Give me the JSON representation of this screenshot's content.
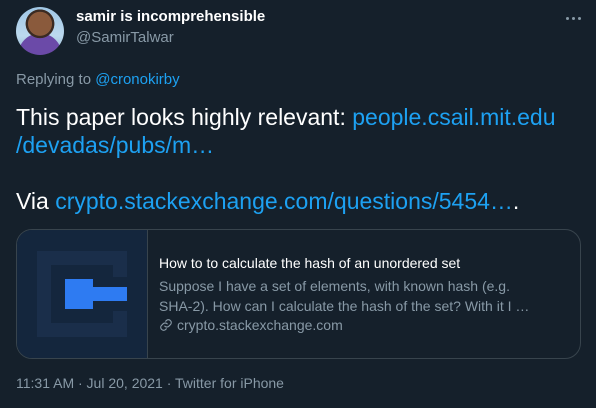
{
  "author": {
    "name": "samir is incomprehensible",
    "handle": "@SamirTalwar"
  },
  "menu": {
    "icon": "more-icon"
  },
  "reply": {
    "prefix": "Replying to",
    "mention": "@cronokirby"
  },
  "tweet": {
    "line1_text": "This paper looks highly relevant: ",
    "line1_link": "people.csail.mit.edu",
    "line2_link": "/devadas/pubs/m…",
    "line3_text": "Via ",
    "line3_link": "crypto.stackexchange.com/questions/5454…",
    "line3_suffix": "."
  },
  "card": {
    "thumbnail_icon": "stackexchange-crypto-logo",
    "title": "How to to calculate the hash of an unordered set",
    "desc_line1": "Suppose I have a set of elements, with known hash (e.g.",
    "desc_line2": "SHA-2). How can I calculate the hash of the set? With it I …",
    "domain": "crypto.stackexchange.com",
    "domain_icon": "link-icon"
  },
  "meta": {
    "time": "11:31 AM · Jul 20, 2021 · Twitter for iPhone"
  },
  "colors": {
    "background": "#15202b",
    "accent": "#1da1f2",
    "secondary_text": "#8899a6",
    "border": "#38444d"
  }
}
